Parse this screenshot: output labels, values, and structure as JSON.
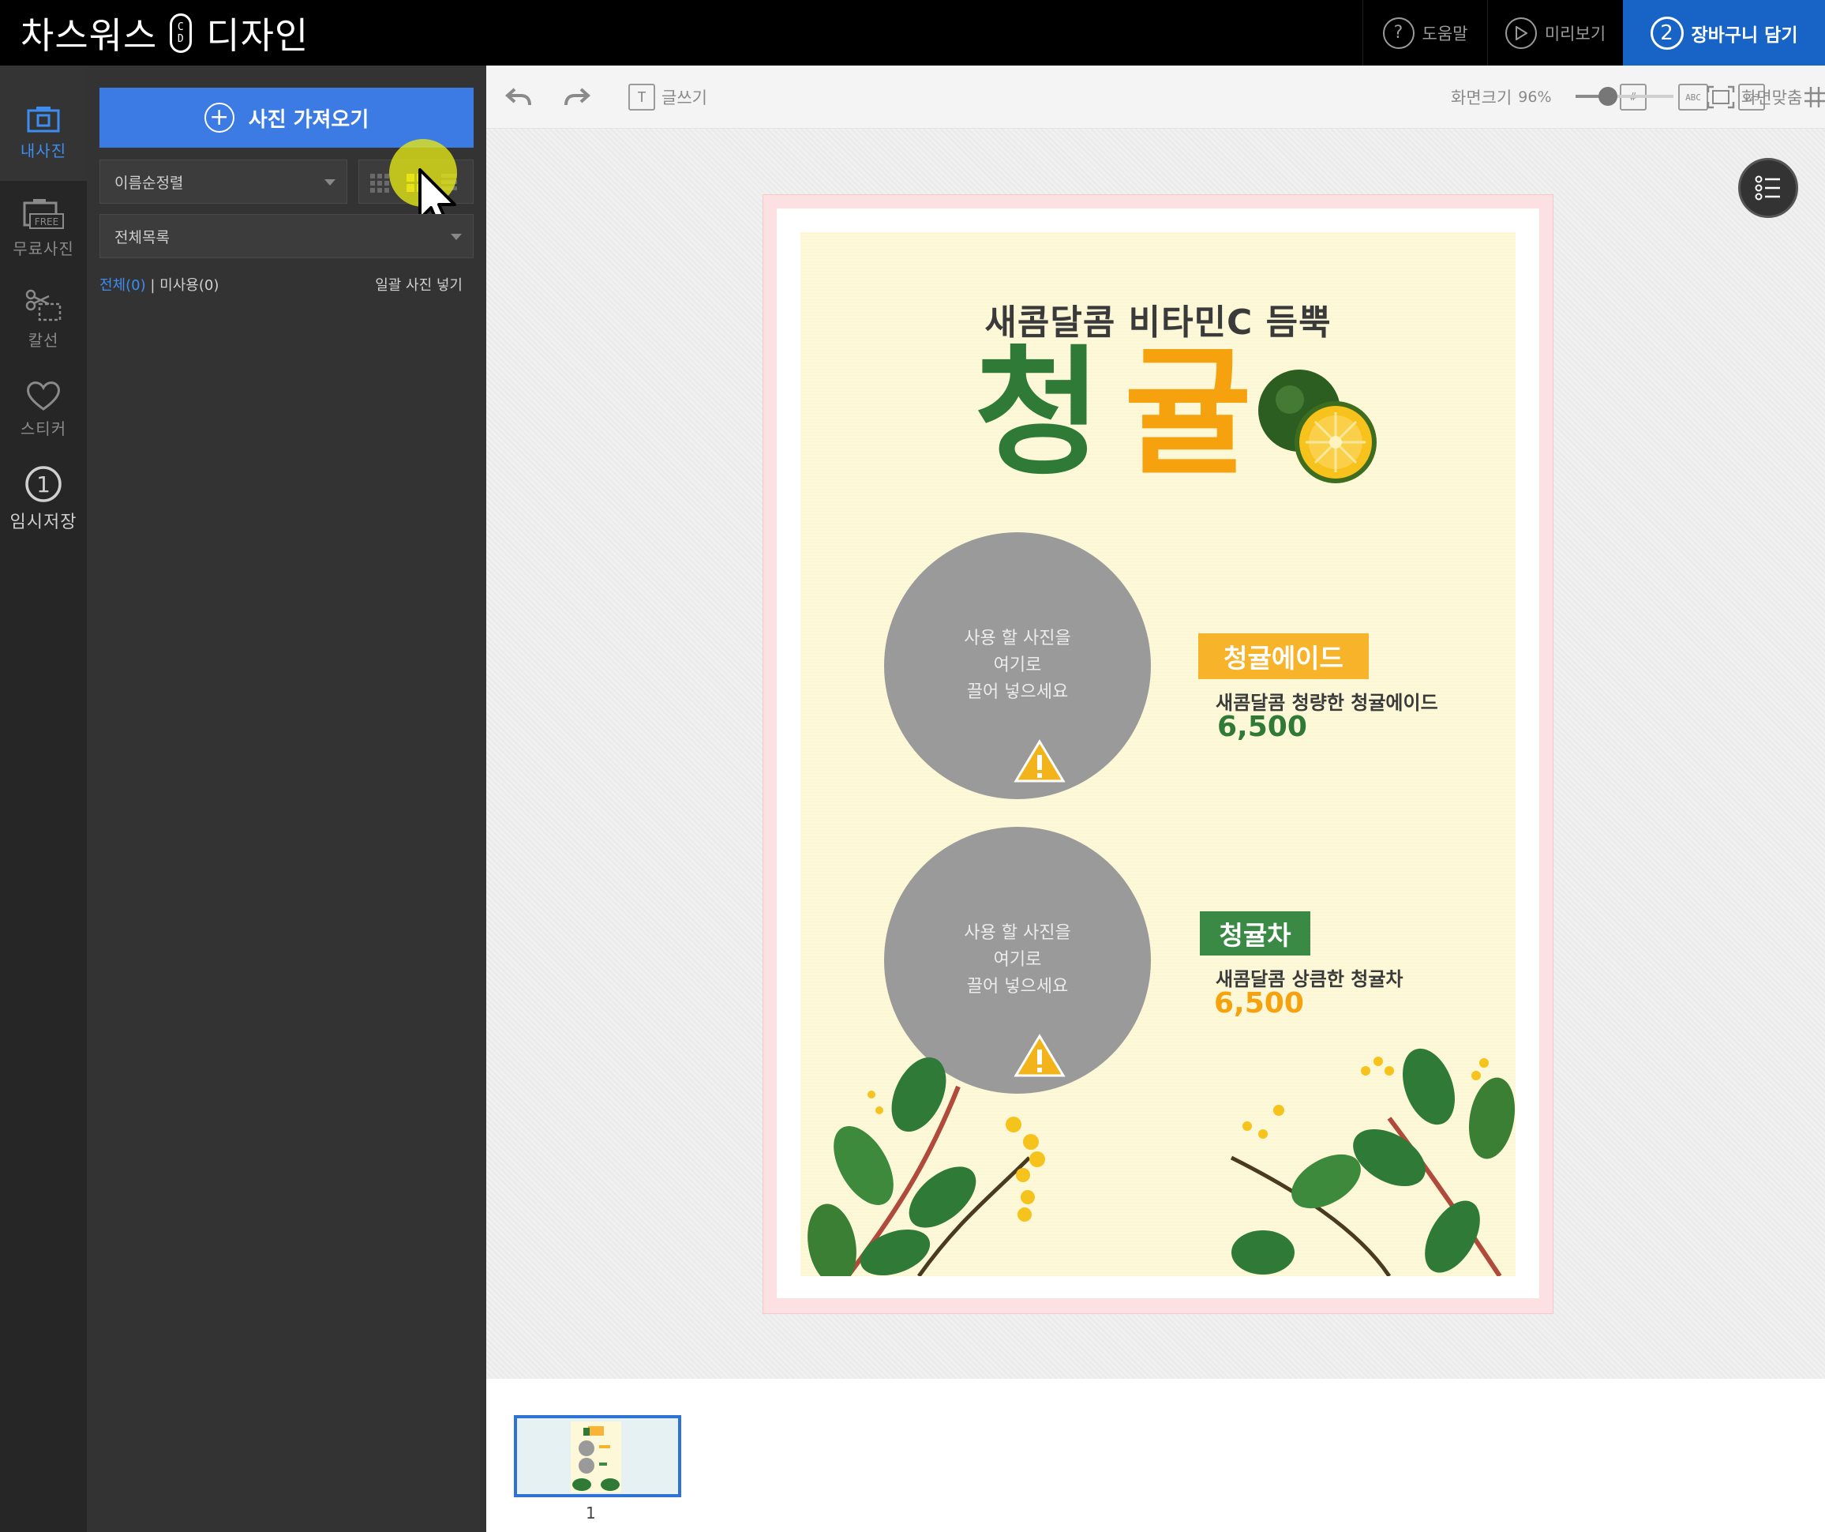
{
  "topbar": {
    "brand_left": "차스워스",
    "brand_badge_top": "C",
    "brand_badge_bottom": "D",
    "brand_right": "디자인",
    "help_label": "도움말",
    "help_icon": "?",
    "preview_label": "미리보기",
    "cart_number": "2",
    "cart_label": "장바구니 담기"
  },
  "rail": {
    "items": [
      {
        "label": "내사진",
        "icon": "camera-icon"
      },
      {
        "label": "무료사진",
        "icon": "free-photo-icon"
      },
      {
        "label": "칼선",
        "icon": "scissors-icon"
      },
      {
        "label": "스티커",
        "icon": "heart-icon"
      },
      {
        "label": "임시저장",
        "icon": "temp-save-icon",
        "number": "1"
      }
    ]
  },
  "panel": {
    "import_label": "사진 가져오기",
    "sort_value": "이름순정렬",
    "folder_value": "전체목록",
    "filter_all": "전체(0)",
    "filter_sep": "|",
    "filter_unused": "미사용(0)",
    "bulk_label": "일괄 사진 넣기"
  },
  "toolbar": {
    "write_label": "글쓰기",
    "tool_hash_icon": "#",
    "tool_abc_icon": "ABC",
    "tool_123_icon": "123",
    "zoom_label": "화면크기",
    "zoom_value": "96%",
    "zoom_level": 0.33,
    "fit_label": "화면맞춤"
  },
  "poster": {
    "subtitle": "새콤달콤 비타민C 듬뿍",
    "title_char_1": "청",
    "title_char_2": "귤",
    "drop_text_1": "사용 할 사진을",
    "drop_text_2": "여기로",
    "drop_text_3": "끌어 넣으세요",
    "item1_tag": "청귤에이드",
    "item1_desc": "새콤달콤 청량한 청귤에이드",
    "item1_price": "6,500",
    "item2_tag": "청귤차",
    "item2_desc": "새콤달콤 상큼한 청귤차",
    "item2_price": "6,500"
  },
  "pages": {
    "current": "1"
  },
  "colors": {
    "brand_blue": "#1763c6",
    "import_blue": "#3b7be3",
    "green": "#2f7a37",
    "orange": "#f5a20e",
    "tag_orange": "#f7b32a",
    "tag_green": "#3a8a45"
  }
}
